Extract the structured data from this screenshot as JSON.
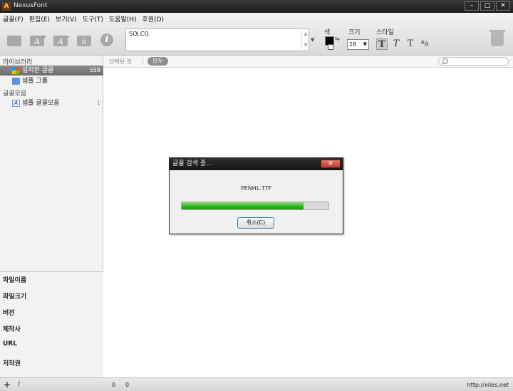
{
  "window": {
    "title": "NexusFont"
  },
  "menu": [
    "글꼴(F)",
    "편집(E)",
    "보기(V)",
    "도구(T)",
    "도움말(H)",
    "후원(D)"
  ],
  "toolbar": {
    "preview_text": "SOLCO.",
    "color_label": "색",
    "size_label": "크기",
    "size_value": "28",
    "style_label": "스타일",
    "style_buttons": [
      "T",
      "T",
      "T",
      "ªa"
    ]
  },
  "sidebar": {
    "library_header": "라이브러리",
    "library_items": [
      {
        "label": "설치된 글꼴",
        "count": "558"
      },
      {
        "label": "샘플 그룹",
        "count": ""
      }
    ],
    "collection_header": "글꼴모음",
    "collection_items": [
      {
        "label": "샘플 글꼴모음",
        "count": "1"
      }
    ]
  },
  "tabs": {
    "selected_label": "선택된 것",
    "all_label": "모두"
  },
  "info_panel": [
    "파일이름",
    "파일크기",
    "버전",
    "제작사",
    "URL",
    "저작권"
  ],
  "dialog": {
    "title": "글꼴 검색 중...",
    "filename": "PENHL.TTF",
    "progress": 0.83,
    "cancel_label": "취소(C)"
  },
  "status": {
    "count1": "0",
    "count2": "0",
    "url": "http://xiles.net"
  },
  "colors": {
    "progress": "#2fb521",
    "titlebar": "#1c1c1c",
    "selected": "#7a7a7a"
  }
}
